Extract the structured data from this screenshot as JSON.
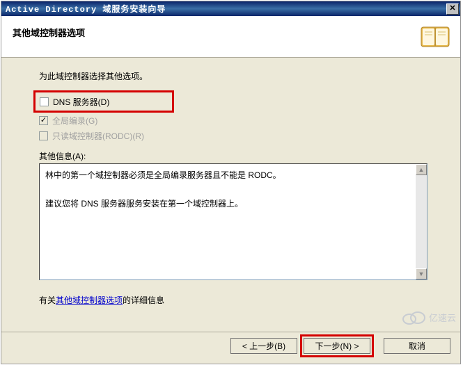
{
  "title": "Active Directory 域服务安装向导",
  "header": {
    "subtitle": "其他域控制器选项"
  },
  "content": {
    "intro": "为此域控制器选择其他选项。",
    "checkboxes": {
      "dns": {
        "label": "DNS 服务器(D)",
        "checked": false
      },
      "gc": {
        "label": "全局编录(G)",
        "checked": true,
        "disabled": true
      },
      "rodc": {
        "label": "只读域控制器(RODC)(R)",
        "checked": false,
        "disabled": true
      }
    },
    "info_label": "其他信息(A):",
    "info_text_1": "林中的第一个域控制器必须是全局编录服务器且不能是 RODC。",
    "info_text_2": "建议您将 DNS 服务器服务安装在第一个域控制器上。",
    "footer_prefix": "有关",
    "footer_link": "其他域控制器选项",
    "footer_suffix": "的详细信息"
  },
  "buttons": {
    "back": "< 上一步(B)",
    "next": "下一步(N) >",
    "cancel": "取消"
  },
  "watermark": "亿速云"
}
